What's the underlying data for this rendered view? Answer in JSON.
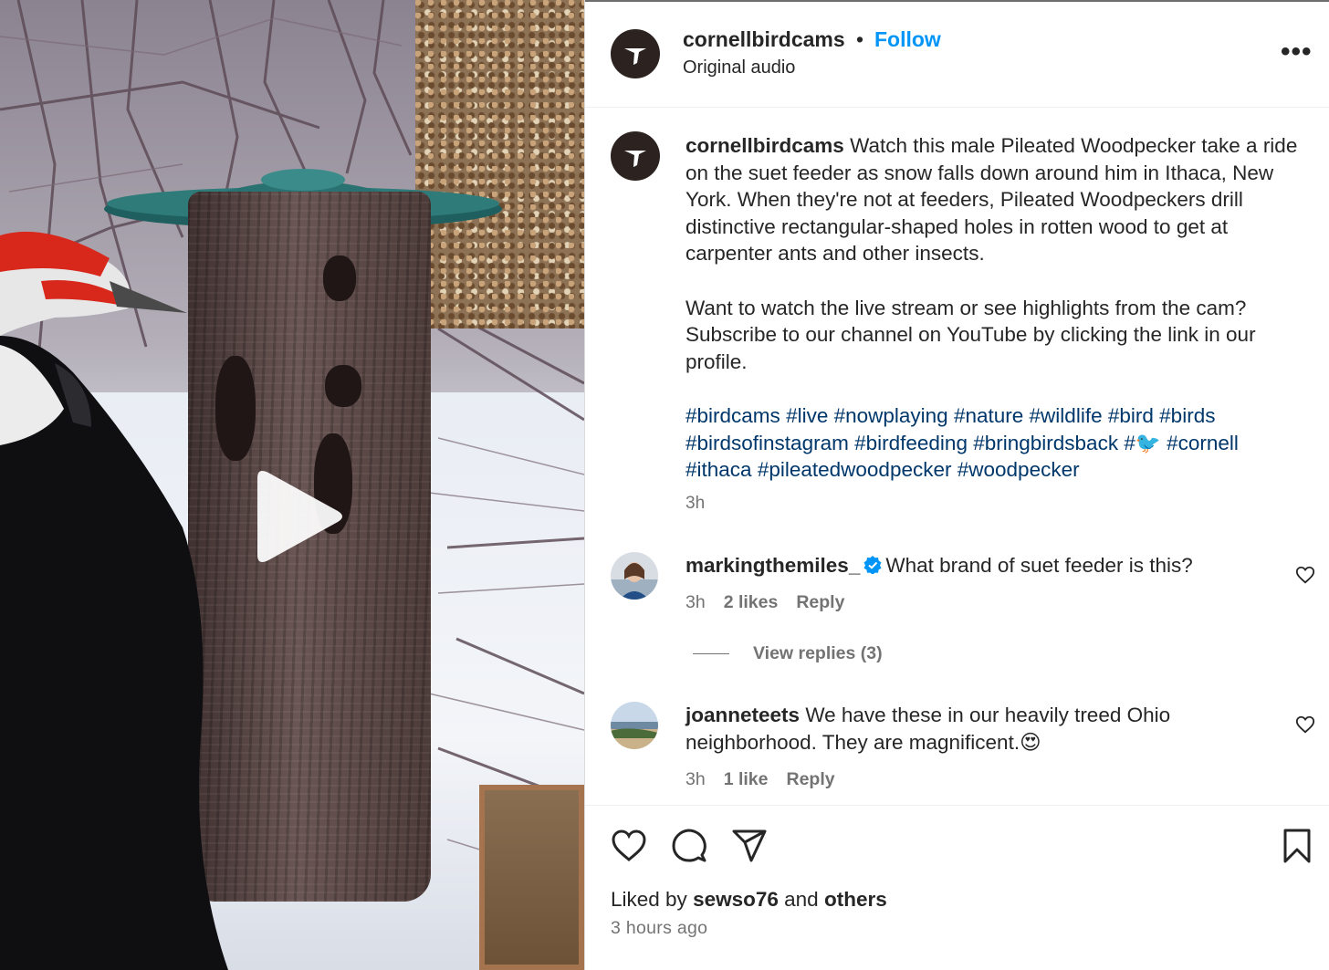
{
  "post": {
    "username": "cornellbirdcams",
    "dot": "•",
    "follow_label": "Follow",
    "audio": "Original audio",
    "more_label": "•••"
  },
  "caption": {
    "username": "cornellbirdcams",
    "paragraph1": "Watch this male Pileated Woodpecker take a ride on the suet feeder as snow falls down around him in Ithaca, New York. When they're not at feeders, Pileated Woodpeckers drill distinctive rectangular-shaped holes in rotten wood to get at carpenter ants and other insects.",
    "paragraph2": "Want to watch the live stream or see highlights from the cam? Subscribe to our channel on YouTube by clicking the link in our profile.",
    "hashtags": [
      "#birdcams",
      "#live",
      "#nowplaying",
      "#nature",
      "#wildlife",
      "#bird",
      "#birds",
      "#birdsofinstagram",
      "#birdfeeding",
      "#bringbirdsback",
      "#🐦",
      "#cornell",
      "#ithaca",
      "#pileatedwoodpecker",
      "#woodpecker"
    ],
    "time": "3h"
  },
  "comments": [
    {
      "username": "markingthemiles_",
      "verified": true,
      "text": "What brand of suet feeder is this?",
      "time": "3h",
      "likes": "2 likes",
      "reply_label": "Reply"
    },
    {
      "username": "joanneteets",
      "verified": false,
      "text": "We have these in our heavily treed Ohio neighborhood. They are magnificent.😍",
      "time": "3h",
      "likes": "1 like",
      "reply_label": "Reply"
    }
  ],
  "view_replies": "View replies (3)",
  "footer": {
    "liked_prefix": "Liked by",
    "liked_user": "sewso76",
    "liked_and": "and",
    "liked_others": "others",
    "time_ago": "3 hours ago"
  },
  "icons": {
    "like": "heart-icon",
    "comment": "comment-icon",
    "share": "paper-plane-icon",
    "save": "bookmark-icon",
    "play": "play-icon",
    "verified": "verified-badge-icon"
  },
  "colors": {
    "link_blue": "#0095f6",
    "hashtag": "#00376b",
    "muted": "#737373",
    "verified": "#0095f6"
  }
}
